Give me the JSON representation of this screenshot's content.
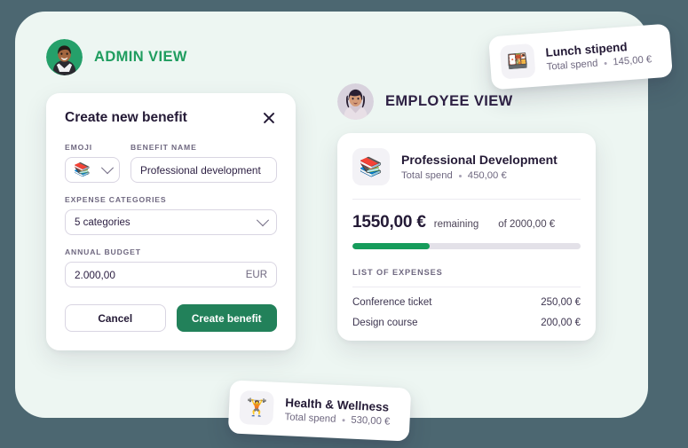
{
  "theme": {
    "page_background": "#4c6771",
    "stage_background": "#edf6f2",
    "card_background": "#ffffff",
    "accent_green": "#1f9d5f",
    "button_green": "#22815a",
    "progress_green": "#169c5b",
    "heading_purple": "#241a36",
    "muted_purple": "#6f6880"
  },
  "admin": {
    "label": "ADMIN VIEW",
    "avatar_name": "admin-avatar"
  },
  "employee": {
    "label": "EMPLOYEE VIEW",
    "avatar_name": "employee-avatar"
  },
  "dialog": {
    "title": "Create new benefit",
    "close_icon": "close-icon",
    "emoji": {
      "label": "EMOJI",
      "value": "📚",
      "chevron_icon": "chevron-down-icon"
    },
    "benefit_name": {
      "label": "BENEFIT NAME",
      "value": "Professional development",
      "placeholder": "Benefit name"
    },
    "expense_categories": {
      "label": "EXPENSE CATEGORIES",
      "value": "5 categories",
      "chevron_icon": "chevron-down-icon"
    },
    "annual_budget": {
      "label": "ANNUAL BUDGET",
      "value": "2.000,00",
      "placeholder": "0,00",
      "currency": "EUR"
    },
    "cancel_label": "Cancel",
    "create_label": "Create benefit"
  },
  "benefit_card": {
    "emoji": "📚",
    "name": "Professional Development",
    "spend_label": "Total spend",
    "spend_value": "450,00 €",
    "remaining_amount": "1550,00 €",
    "remaining_word": "remaining",
    "of_total": "of 2000,00 €",
    "progress_percent": 34,
    "expenses_title": "LIST OF EXPENSES",
    "expenses": [
      {
        "name": "Conference ticket",
        "amount": "250,00 €"
      },
      {
        "name": "Design course",
        "amount": "200,00 €"
      }
    ]
  },
  "chips": [
    {
      "emoji": "🍱",
      "name": "Lunch stipend",
      "spend_label": "Total spend",
      "spend_value": "145,00 €"
    },
    {
      "emoji": "🏋️",
      "name": "Health & Wellness",
      "spend_label": "Total spend",
      "spend_value": "530,00 €"
    }
  ]
}
